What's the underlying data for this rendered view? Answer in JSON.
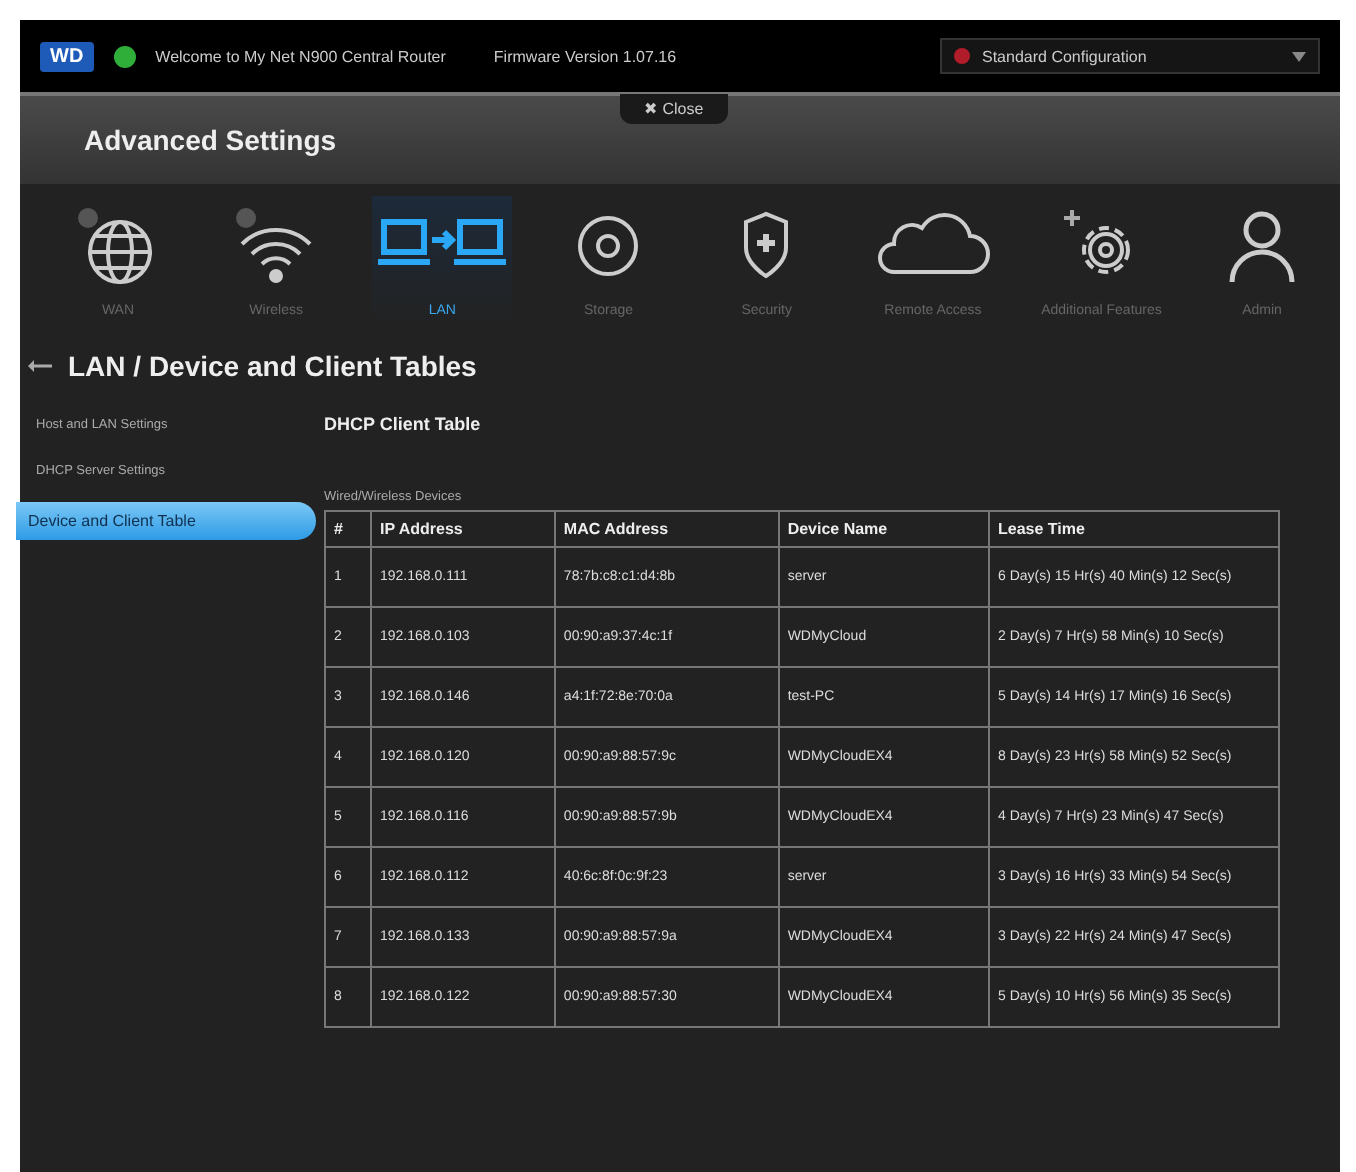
{
  "top_bar": {
    "logo": "WD",
    "welcome": "Welcome to My Net N900 Central Router",
    "firmware": "Firmware Version 1.07.16",
    "configuration": "Standard Configuration"
  },
  "header": {
    "title": "Advanced Settings",
    "close_button": "✖ Close"
  },
  "nav": [
    {
      "label": "WAN",
      "selected": false
    },
    {
      "label": "Wireless",
      "selected": false
    },
    {
      "label": "LAN",
      "selected": true
    },
    {
      "label": "Storage",
      "selected": false
    },
    {
      "label": "Security",
      "selected": false
    },
    {
      "label": "Remote Access",
      "selected": false
    },
    {
      "label": "Additional Features",
      "selected": false
    },
    {
      "label": "Admin",
      "selected": false
    }
  ],
  "page_title": "LAN / Device and Client Tables",
  "sidebar": [
    {
      "label": "Host and LAN Settings",
      "selected": false
    },
    {
      "label": "DHCP Server Settings",
      "selected": false
    },
    {
      "label": "Device and Client Table",
      "selected": true
    }
  ],
  "section_title": "DHCP Client Table",
  "table": {
    "caption": "Wired/Wireless Devices",
    "columns": [
      "#",
      "IP Address",
      "MAC Address",
      "Device Name",
      "Lease Time"
    ],
    "rows": [
      [
        "1",
        "192.168.0.111",
        "78:7b:c8:c1:d4:8b",
        "server",
        "6 Day(s) 15 Hr(s) 40 Min(s) 12 Sec(s)"
      ],
      [
        "2",
        "192.168.0.103",
        "00:90:a9:37:4c:1f",
        "WDMyCloud",
        "2 Day(s) 7 Hr(s) 58 Min(s) 10 Sec(s)"
      ],
      [
        "3",
        "192.168.0.146",
        "a4:1f:72:8e:70:0a",
        "test-PC",
        "5 Day(s) 14 Hr(s) 17 Min(s) 16 Sec(s)"
      ],
      [
        "4",
        "192.168.0.120",
        "00:90:a9:88:57:9c",
        "WDMyCloudEX4",
        "8 Day(s) 23 Hr(s) 58 Min(s) 52 Sec(s)"
      ],
      [
        "5",
        "192.168.0.116",
        "00:90:a9:88:57:9b",
        "WDMyCloudEX4",
        "4 Day(s) 7 Hr(s) 23 Min(s) 47 Sec(s)"
      ],
      [
        "6",
        "192.168.0.112",
        "40:6c:8f:0c:9f:23",
        "server",
        "3 Day(s) 16 Hr(s) 33 Min(s) 54 Sec(s)"
      ],
      [
        "7",
        "192.168.0.133",
        "00:90:a9:88:57:9a",
        "WDMyCloudEX4",
        "3 Day(s) 22 Hr(s) 24 Min(s) 47 Sec(s)"
      ],
      [
        "8",
        "192.168.0.122",
        "00:90:a9:88:57:30",
        "WDMyCloudEX4",
        "5 Day(s) 10 Hr(s) 56 Min(s) 35 Sec(s)"
      ]
    ]
  }
}
